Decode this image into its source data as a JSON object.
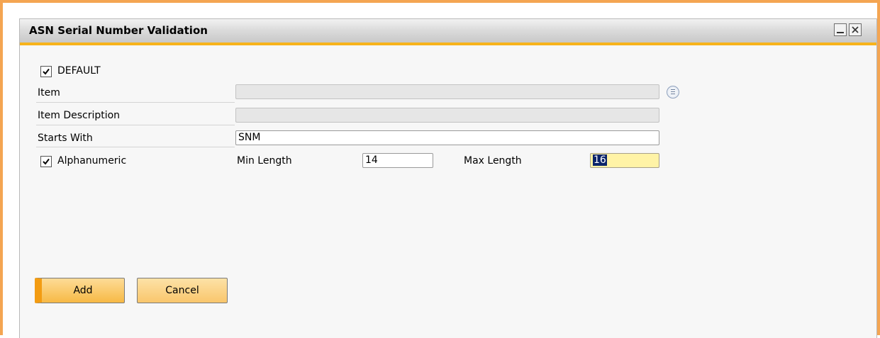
{
  "window": {
    "title": "ASN Serial Number Validation",
    "controls": [
      "minimize-icon",
      "close-icon"
    ]
  },
  "form": {
    "default_checkbox": {
      "label": "DEFAULT",
      "checked": true
    },
    "item": {
      "label": "Item",
      "value": "",
      "lookup_icon": "list-lookup-icon"
    },
    "item_description": {
      "label": "Item Description",
      "value": ""
    },
    "starts_with": {
      "label": "Starts With",
      "value": "SNM"
    },
    "alphanumeric_checkbox": {
      "label": "Alphanumeric",
      "checked": true
    },
    "min_length": {
      "label": "Min Length",
      "value": "14"
    },
    "max_length": {
      "label": "Max Length",
      "value": "16"
    }
  },
  "buttons": {
    "add_label": "Add",
    "cancel_label": "Cancel"
  },
  "colors": {
    "frame_border": "#f4a552",
    "title_underline": "#f7b31b",
    "button_fill": "#f9c66c",
    "focused_field": "#fff3a6"
  }
}
